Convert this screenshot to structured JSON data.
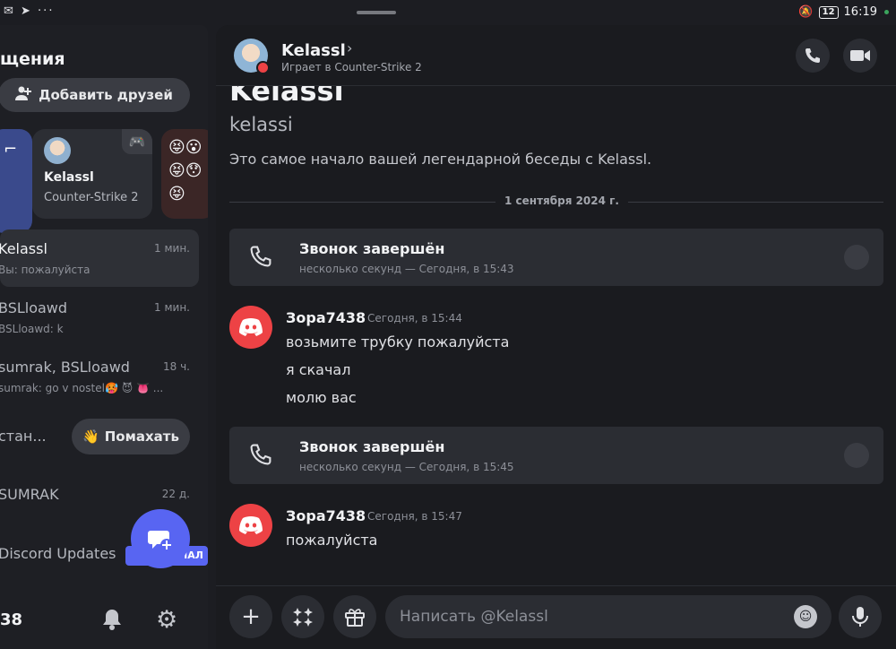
{
  "status_bar": {
    "time": "16:19",
    "battery": "12"
  },
  "sidebar": {
    "heading": "щения",
    "add_friends_label": "Добавить друзей",
    "active_card": {
      "name": "Kelassl",
      "game": "Counter-Strike 2"
    },
    "dms": [
      {
        "name": "Kelassl",
        "preview": "Вы: пожалуйста",
        "time": "1 мин."
      },
      {
        "name": "BSLloawd",
        "preview": "BSLloawd: k",
        "time": "1 мин."
      },
      {
        "name": "sumrak, BSLloawd",
        "preview": "sumrak: go v nostel🥵 😈 👅 ...",
        "time": "18 ч."
      },
      {
        "name": "стан...",
        "preview": "",
        "time": ""
      },
      {
        "name": "SUMRAK",
        "preview": "",
        "time": "22 д."
      },
      {
        "name": "Discord Updates",
        "preview": "",
        "time": ""
      }
    ],
    "wave_label": "Помахать",
    "official_badge": "ИАЛ",
    "bottom_count": "38"
  },
  "chat": {
    "header": {
      "name": "Kelassl",
      "status": "Играет в Counter-Strike 2"
    },
    "intro": {
      "display_name": "Kelassl",
      "username": "kelassi",
      "text": "Это самое начало вашей легендарной беседы с Kelassl."
    },
    "date_divider": "1 сентября 2024 г.",
    "calls": [
      {
        "title": "Звонок завершён",
        "subtitle": "несколько секунд — Сегодня, в 15:43"
      },
      {
        "title": "Звонок завершён",
        "subtitle": "несколько секунд — Сегодня, в 15:45"
      }
    ],
    "messages": [
      {
        "author": "Зора7438",
        "time": "Сегодня, в 15:44",
        "lines": [
          "возьмите трубку пожалуйста",
          "я скачал",
          "молю вас"
        ]
      },
      {
        "author": "Зора7438",
        "time": "Сегодня, в 15:47",
        "lines": [
          "пожалуйста"
        ]
      }
    ],
    "composer_placeholder": "Написать @Kelassl"
  }
}
